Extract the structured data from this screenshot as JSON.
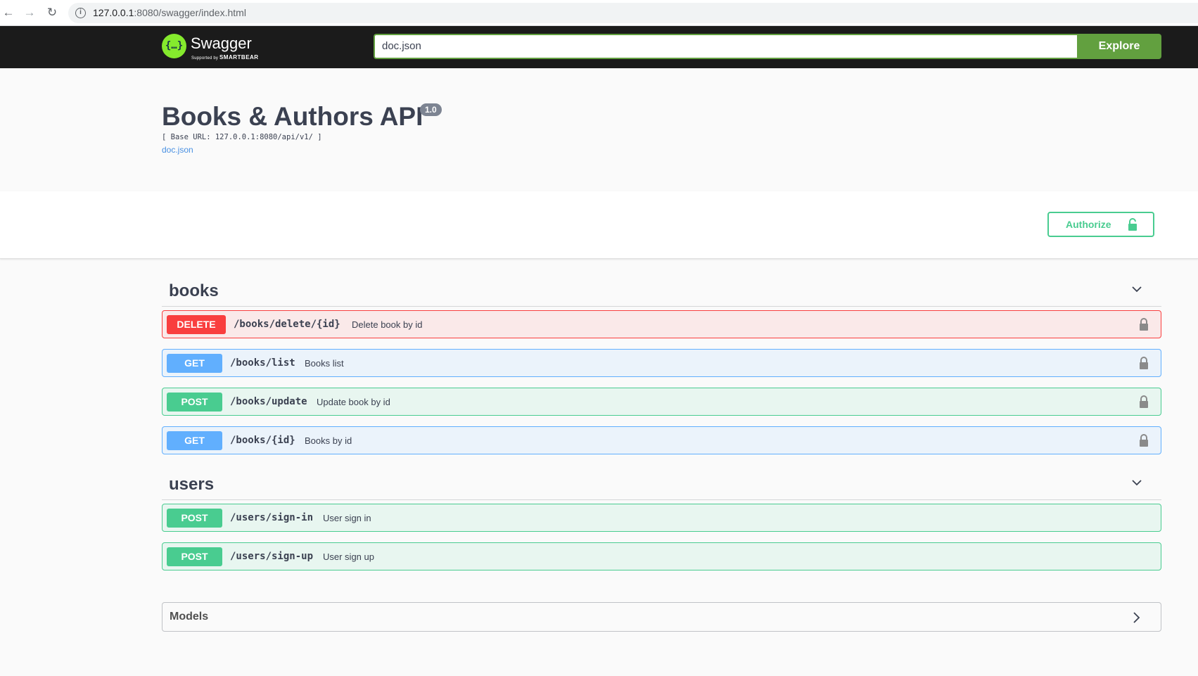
{
  "browser": {
    "url_host": "127.0.0.1",
    "url_path": ":8080/swagger/index.html"
  },
  "topbar": {
    "logo_text": "Swagger",
    "logo_sub_prefix": "Supported by",
    "logo_sub_brand": "SMARTBEAR",
    "spec_url_value": "doc.json",
    "explore_label": "Explore"
  },
  "info": {
    "title": "Books & Authors API",
    "version": "1.0",
    "base_url": "[ Base URL: 127.0.0.1:8080/api/v1/ ]",
    "spec_link": "doc.json"
  },
  "auth": {
    "authorize_label": "Authorize"
  },
  "tags": [
    {
      "name": "books",
      "operations": [
        {
          "method": "DELETE",
          "path": "/books/delete/{id}",
          "summary": "Delete book by id"
        },
        {
          "method": "GET",
          "path": "/books/list",
          "summary": "Books list"
        },
        {
          "method": "POST",
          "path": "/books/update",
          "summary": "Update book by id"
        },
        {
          "method": "GET",
          "path": "/books/{id}",
          "summary": "Books by id"
        }
      ]
    },
    {
      "name": "users",
      "operations": [
        {
          "method": "POST",
          "path": "/users/sign-in",
          "summary": "User sign in"
        },
        {
          "method": "POST",
          "path": "/users/sign-up",
          "summary": "User sign up"
        }
      ]
    }
  ],
  "models": {
    "title": "Models"
  },
  "colors": {
    "delete": "#f93e3e",
    "get": "#61affe",
    "post": "#49cc90",
    "explore": "#62a03f"
  }
}
